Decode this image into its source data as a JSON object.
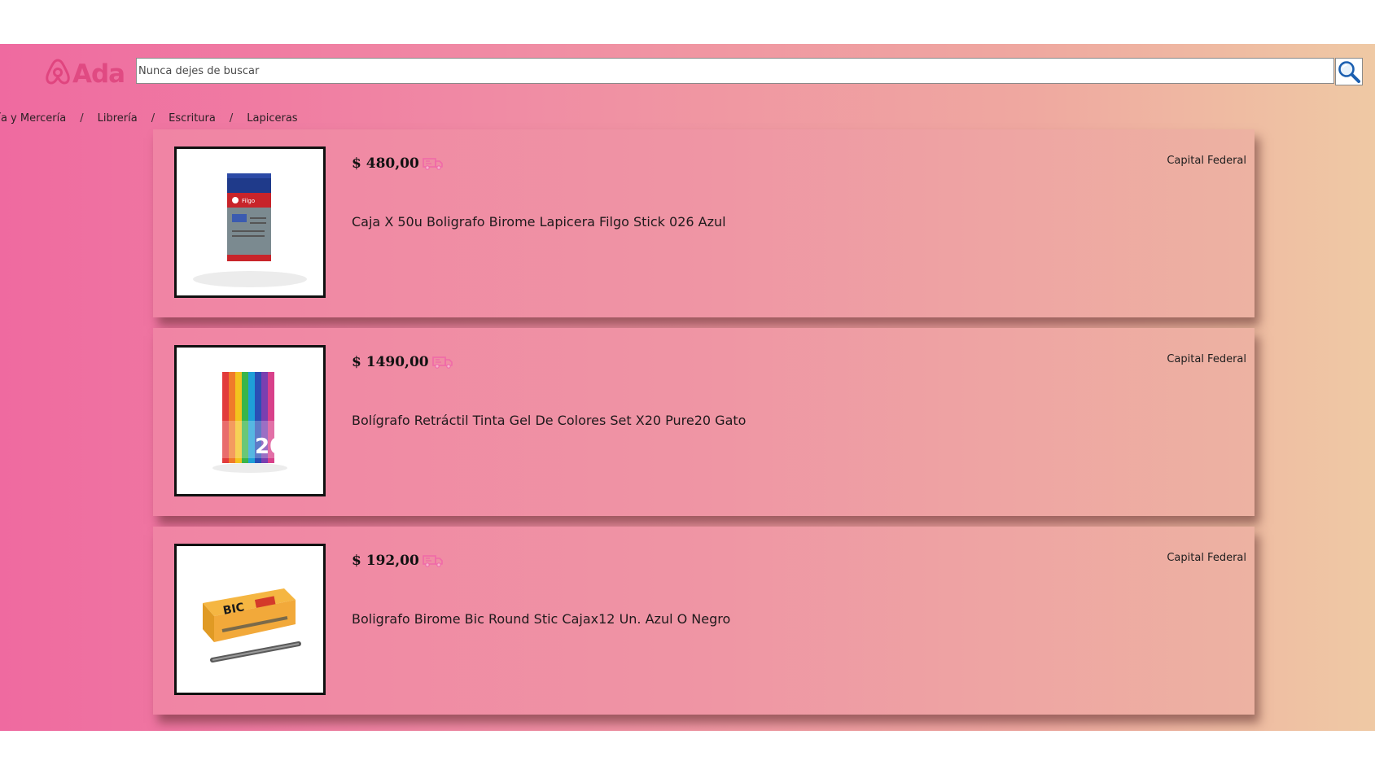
{
  "header": {
    "logo_text": "Ada",
    "search": {
      "placeholder": "Nunca dejes de buscar",
      "value": ""
    },
    "search_icon": "magnifier-icon"
  },
  "breadcrumb": {
    "items": [
      {
        "label": "ría y Mercería"
      },
      {
        "label": "Librería"
      },
      {
        "label": "Escritura"
      },
      {
        "label": "Lapiceras"
      }
    ],
    "separator": "/"
  },
  "colors": {
    "gradient_left": "#ef6aa0",
    "gradient_right": "#efc9a4",
    "logo": "#e04a82",
    "shipping_icon": "#f06aa8"
  },
  "products": [
    {
      "price": "$ 480,00",
      "title": "Caja X 50u Boligrafo Birome Lapicera Filgo Stick 026 Azul",
      "location": "Capital Federal",
      "shipping_icon": "truck-icon",
      "image_label": "Filgo"
    },
    {
      "price": "$ 1490,00",
      "title": "Bolígrafo Retráctil Tinta Gel De Colores Set X20 Pure20 Gato",
      "location": "Capital Federal",
      "shipping_icon": "truck-icon",
      "image_label": "20"
    },
    {
      "price": "$ 192,00",
      "title": "Boligrafo Birome Bic Round Stic Cajax12 Un. Azul O Negro",
      "location": "Capital Federal",
      "shipping_icon": "truck-icon",
      "image_label": "BIC"
    }
  ]
}
